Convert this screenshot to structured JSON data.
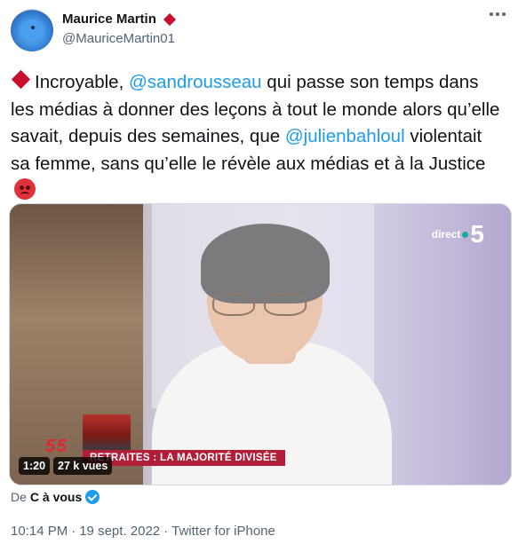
{
  "author": {
    "display_name": "Maurice Martin",
    "handle": "@MauriceMartin01",
    "avatar_icon": "bluebird-avatar"
  },
  "tweet": {
    "parts": [
      {
        "type": "emoji",
        "icon": "red-diamond-icon"
      },
      {
        "type": "text",
        "value": "Incroyable, "
      },
      {
        "type": "mention",
        "value": "@sandrousseau"
      },
      {
        "type": "text",
        "value": " qui passe son temps dans les médias à donner des leçons à tout le monde alors qu’elle savait, depuis des semaines, que "
      },
      {
        "type": "mention",
        "value": "@julienbahloul"
      },
      {
        "type": "text",
        "value": " violentait sa femme, sans qu’elle le révèle aux médias et à la Justice "
      },
      {
        "type": "emoji",
        "icon": "angry-face-icon"
      }
    ]
  },
  "video": {
    "duration": "1:20",
    "views": "27 k vues",
    "channel_logo": "direct 5",
    "channel_text": "direct",
    "channel_number": "5",
    "ticker_text": "RETRAITES : LA MAJORITÉ DIVISÉE",
    "show_logo": "5 5"
  },
  "source": {
    "prefix": "De",
    "name": "C à vous"
  },
  "meta": {
    "time": "10:14 PM",
    "date": "19 sept. 2022",
    "client": "Twitter for iPhone"
  },
  "colors": {
    "link": "#1d9bf0",
    "text": "#0f1419",
    "secondary": "#536471",
    "accent_red": "#c8102e"
  }
}
